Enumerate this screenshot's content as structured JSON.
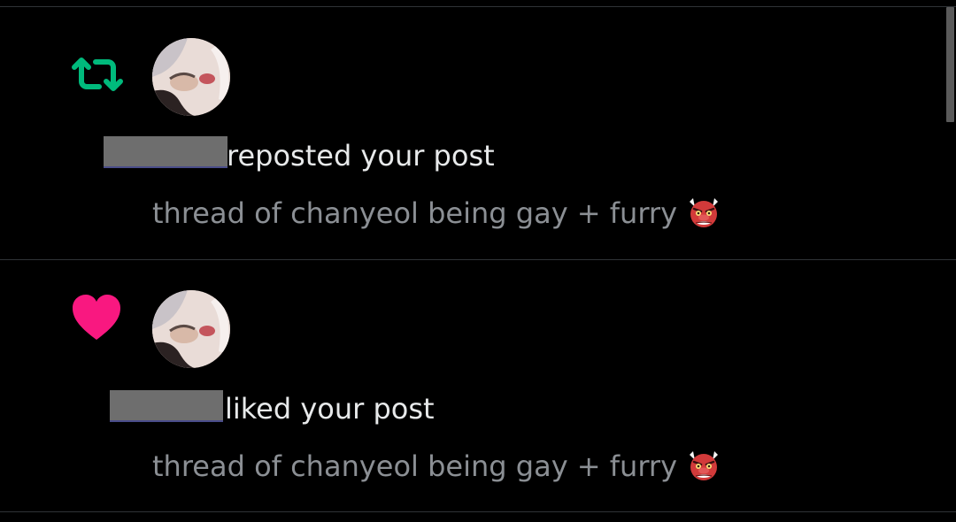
{
  "notifications": [
    {
      "type": "repost",
      "type_icon": "repost-icon",
      "icon_color": "#00ba7c",
      "action_text": "reposted your post",
      "post_preview": "thread of chanyeol being gay + furry",
      "emoji": "goblin-emoji"
    },
    {
      "type": "like",
      "type_icon": "heart-icon",
      "icon_color": "#f91880",
      "action_text": "liked your post",
      "post_preview": "thread of chanyeol being gay + furry",
      "emoji": "goblin-emoji"
    }
  ],
  "colors": {
    "background": "#000000",
    "divider": "#2f3336",
    "primary_text": "#e7e9ea",
    "secondary_text": "#8b8f94"
  }
}
